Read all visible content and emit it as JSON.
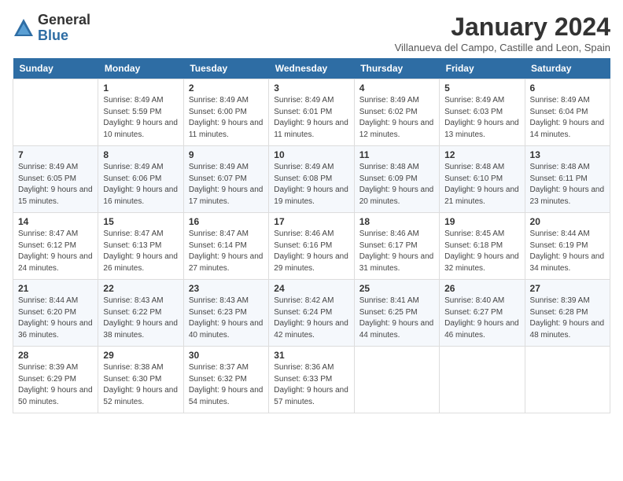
{
  "header": {
    "logo_general": "General",
    "logo_blue": "Blue",
    "title": "January 2024",
    "subtitle": "Villanueva del Campo, Castille and Leon, Spain"
  },
  "weekdays": [
    "Sunday",
    "Monday",
    "Tuesday",
    "Wednesday",
    "Thursday",
    "Friday",
    "Saturday"
  ],
  "weeks": [
    [
      {
        "day": null
      },
      {
        "day": "1",
        "sunrise": "Sunrise: 8:49 AM",
        "sunset": "Sunset: 5:59 PM",
        "daylight": "Daylight: 9 hours and 10 minutes."
      },
      {
        "day": "2",
        "sunrise": "Sunrise: 8:49 AM",
        "sunset": "Sunset: 6:00 PM",
        "daylight": "Daylight: 9 hours and 11 minutes."
      },
      {
        "day": "3",
        "sunrise": "Sunrise: 8:49 AM",
        "sunset": "Sunset: 6:01 PM",
        "daylight": "Daylight: 9 hours and 11 minutes."
      },
      {
        "day": "4",
        "sunrise": "Sunrise: 8:49 AM",
        "sunset": "Sunset: 6:02 PM",
        "daylight": "Daylight: 9 hours and 12 minutes."
      },
      {
        "day": "5",
        "sunrise": "Sunrise: 8:49 AM",
        "sunset": "Sunset: 6:03 PM",
        "daylight": "Daylight: 9 hours and 13 minutes."
      },
      {
        "day": "6",
        "sunrise": "Sunrise: 8:49 AM",
        "sunset": "Sunset: 6:04 PM",
        "daylight": "Daylight: 9 hours and 14 minutes."
      }
    ],
    [
      {
        "day": "7",
        "sunrise": "Sunrise: 8:49 AM",
        "sunset": "Sunset: 6:05 PM",
        "daylight": "Daylight: 9 hours and 15 minutes."
      },
      {
        "day": "8",
        "sunrise": "Sunrise: 8:49 AM",
        "sunset": "Sunset: 6:06 PM",
        "daylight": "Daylight: 9 hours and 16 minutes."
      },
      {
        "day": "9",
        "sunrise": "Sunrise: 8:49 AM",
        "sunset": "Sunset: 6:07 PM",
        "daylight": "Daylight: 9 hours and 17 minutes."
      },
      {
        "day": "10",
        "sunrise": "Sunrise: 8:49 AM",
        "sunset": "Sunset: 6:08 PM",
        "daylight": "Daylight: 9 hours and 19 minutes."
      },
      {
        "day": "11",
        "sunrise": "Sunrise: 8:48 AM",
        "sunset": "Sunset: 6:09 PM",
        "daylight": "Daylight: 9 hours and 20 minutes."
      },
      {
        "day": "12",
        "sunrise": "Sunrise: 8:48 AM",
        "sunset": "Sunset: 6:10 PM",
        "daylight": "Daylight: 9 hours and 21 minutes."
      },
      {
        "day": "13",
        "sunrise": "Sunrise: 8:48 AM",
        "sunset": "Sunset: 6:11 PM",
        "daylight": "Daylight: 9 hours and 23 minutes."
      }
    ],
    [
      {
        "day": "14",
        "sunrise": "Sunrise: 8:47 AM",
        "sunset": "Sunset: 6:12 PM",
        "daylight": "Daylight: 9 hours and 24 minutes."
      },
      {
        "day": "15",
        "sunrise": "Sunrise: 8:47 AM",
        "sunset": "Sunset: 6:13 PM",
        "daylight": "Daylight: 9 hours and 26 minutes."
      },
      {
        "day": "16",
        "sunrise": "Sunrise: 8:47 AM",
        "sunset": "Sunset: 6:14 PM",
        "daylight": "Daylight: 9 hours and 27 minutes."
      },
      {
        "day": "17",
        "sunrise": "Sunrise: 8:46 AM",
        "sunset": "Sunset: 6:16 PM",
        "daylight": "Daylight: 9 hours and 29 minutes."
      },
      {
        "day": "18",
        "sunrise": "Sunrise: 8:46 AM",
        "sunset": "Sunset: 6:17 PM",
        "daylight": "Daylight: 9 hours and 31 minutes."
      },
      {
        "day": "19",
        "sunrise": "Sunrise: 8:45 AM",
        "sunset": "Sunset: 6:18 PM",
        "daylight": "Daylight: 9 hours and 32 minutes."
      },
      {
        "day": "20",
        "sunrise": "Sunrise: 8:44 AM",
        "sunset": "Sunset: 6:19 PM",
        "daylight": "Daylight: 9 hours and 34 minutes."
      }
    ],
    [
      {
        "day": "21",
        "sunrise": "Sunrise: 8:44 AM",
        "sunset": "Sunset: 6:20 PM",
        "daylight": "Daylight: 9 hours and 36 minutes."
      },
      {
        "day": "22",
        "sunrise": "Sunrise: 8:43 AM",
        "sunset": "Sunset: 6:22 PM",
        "daylight": "Daylight: 9 hours and 38 minutes."
      },
      {
        "day": "23",
        "sunrise": "Sunrise: 8:43 AM",
        "sunset": "Sunset: 6:23 PM",
        "daylight": "Daylight: 9 hours and 40 minutes."
      },
      {
        "day": "24",
        "sunrise": "Sunrise: 8:42 AM",
        "sunset": "Sunset: 6:24 PM",
        "daylight": "Daylight: 9 hours and 42 minutes."
      },
      {
        "day": "25",
        "sunrise": "Sunrise: 8:41 AM",
        "sunset": "Sunset: 6:25 PM",
        "daylight": "Daylight: 9 hours and 44 minutes."
      },
      {
        "day": "26",
        "sunrise": "Sunrise: 8:40 AM",
        "sunset": "Sunset: 6:27 PM",
        "daylight": "Daylight: 9 hours and 46 minutes."
      },
      {
        "day": "27",
        "sunrise": "Sunrise: 8:39 AM",
        "sunset": "Sunset: 6:28 PM",
        "daylight": "Daylight: 9 hours and 48 minutes."
      }
    ],
    [
      {
        "day": "28",
        "sunrise": "Sunrise: 8:39 AM",
        "sunset": "Sunset: 6:29 PM",
        "daylight": "Daylight: 9 hours and 50 minutes."
      },
      {
        "day": "29",
        "sunrise": "Sunrise: 8:38 AM",
        "sunset": "Sunset: 6:30 PM",
        "daylight": "Daylight: 9 hours and 52 minutes."
      },
      {
        "day": "30",
        "sunrise": "Sunrise: 8:37 AM",
        "sunset": "Sunset: 6:32 PM",
        "daylight": "Daylight: 9 hours and 54 minutes."
      },
      {
        "day": "31",
        "sunrise": "Sunrise: 8:36 AM",
        "sunset": "Sunset: 6:33 PM",
        "daylight": "Daylight: 9 hours and 57 minutes."
      },
      {
        "day": null
      },
      {
        "day": null
      },
      {
        "day": null
      }
    ]
  ]
}
